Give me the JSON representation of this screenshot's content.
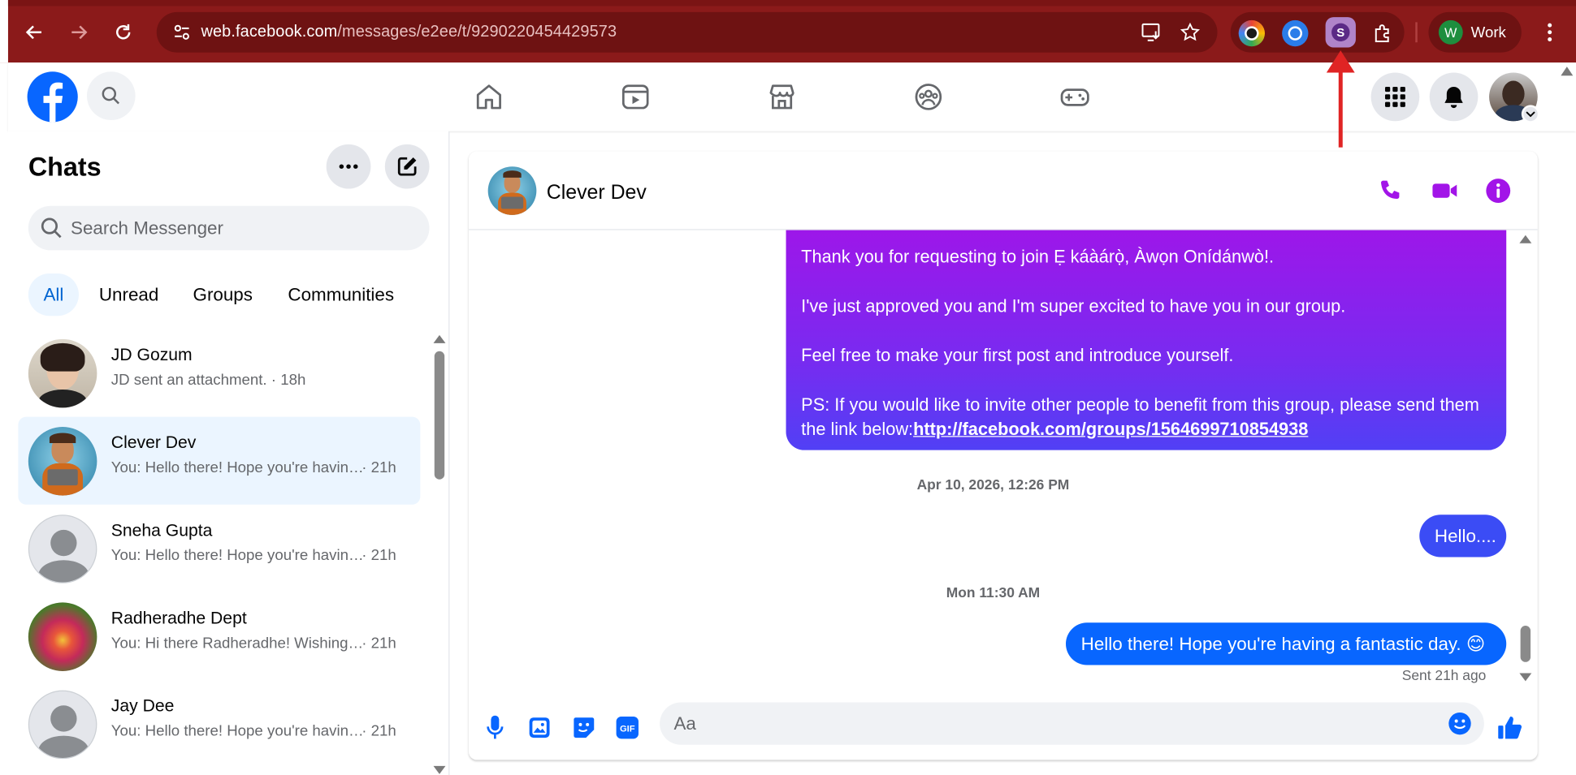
{
  "browser": {
    "url_host": "web.facebook.com",
    "url_path": "/messages/e2ee/t/9290220454429573",
    "profile_initial": "W",
    "profile_name": "Work"
  },
  "sidebar": {
    "title": "Chats",
    "search_placeholder": "Search Messenger",
    "filters": [
      "All",
      "Unread",
      "Groups",
      "Communities"
    ],
    "chats": [
      {
        "name": "JD Gozum",
        "preview": "JD sent an attachment. · 18h",
        "time": ""
      },
      {
        "name": "Clever Dev",
        "preview": "You: Hello there! Hope you're having a fantastic day.",
        "time": "· 21h"
      },
      {
        "name": "Sneha Gupta",
        "preview": "You: Hello there! Hope you're having a fantastic day.",
        "time": "· 21h"
      },
      {
        "name": "Radheradhe Dept",
        "preview": "You: Hi there Radheradhe! Wishing you a great day.",
        "time": "· 21h"
      },
      {
        "name": "Jay Dee",
        "preview": "You: Hello there! Hope you're having a fantastic day.",
        "time": "· 21h"
      }
    ]
  },
  "conversation": {
    "contact_name": "Clever Dev",
    "big_message": {
      "p1": "Thank you for requesting to join Ẹ káàárọ̀, Àwọn Onídánwò!.",
      "p2": "I've just approved you and I'm super excited to have you in our group.",
      "p3": "Feel free to make your first post and introduce yourself.",
      "p4": "PS: If you would like to invite other people to benefit from this group, please send them the link below:",
      "link": "http://facebook.com/groups/1564699710854938"
    },
    "stamp1": "Apr 10, 2026, 12:26 PM",
    "msg1": "Hello....",
    "stamp2": "Mon 11:30 AM",
    "msg2": "Hello there! Hope you're having a fantastic day. 😊",
    "sent_status": "Sent 21h ago",
    "composer_placeholder": "Aa"
  },
  "colors": {
    "chrome_red": "#8b1a1a",
    "fb_blue": "#0866ff",
    "messenger_purple": "#a214e8",
    "selected_bg": "#ebf5ff",
    "annotation_arrow": "#e02424"
  }
}
